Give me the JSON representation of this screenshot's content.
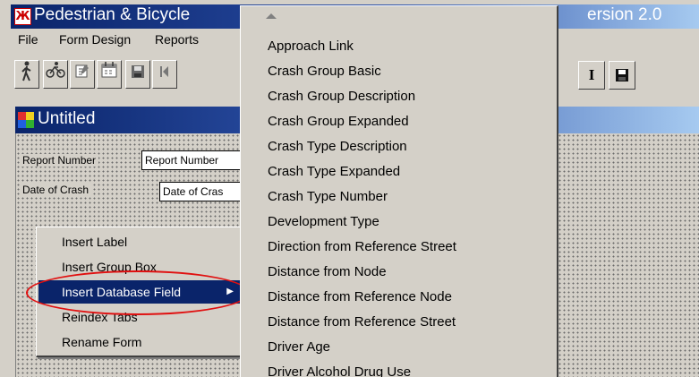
{
  "app": {
    "title": "Pedestrian & Bicycle",
    "version_fragment": "ersion 2.0",
    "icon_symbol": "Ж"
  },
  "menubar": {
    "items": [
      "File",
      "Form Design",
      "Reports"
    ]
  },
  "toolbar": {
    "icons": [
      "walk-icon",
      "bicycle-icon",
      "properties-icon",
      "calendar-icon",
      "save-icon",
      "first-record-icon"
    ],
    "right_icons": [
      "italic-icon",
      "save-icon"
    ],
    "right_glyphs": [
      "I",
      "▪"
    ]
  },
  "form": {
    "title": "Untitled",
    "fields": [
      {
        "label": "Report Number",
        "value": "Report Number"
      },
      {
        "label": "Date of Crash",
        "value": "Date of Cras"
      }
    ]
  },
  "context_menu": {
    "items": [
      {
        "label": "Insert Label",
        "selected": false,
        "submenu": false
      },
      {
        "label": "Insert Group Box",
        "selected": false,
        "submenu": false
      },
      {
        "label": "Insert Database Field",
        "selected": true,
        "submenu": true
      },
      {
        "label": "Reindex Tabs",
        "selected": false,
        "submenu": false
      },
      {
        "label": "Rename Form",
        "selected": false,
        "submenu": false
      }
    ],
    "highlight_color": "#e01010"
  },
  "submenu": {
    "items": [
      "Approach Link",
      "Crash Group Basic",
      "Crash Group Description",
      "Crash Group Expanded",
      "Crash Type Description",
      "Crash Type Expanded",
      "Crash Type Number",
      "Development Type",
      "Direction from Reference Street",
      "Distance from Node",
      "Distance from Reference Node",
      "Distance from Reference Street",
      "Driver Age",
      "Driver Alcohol Drug Use"
    ]
  },
  "colors": {
    "titlebar_dark": "#0a246a",
    "titlebar_light": "#a6caf0",
    "face": "#d4d0c8",
    "selection": "#0a246a"
  }
}
